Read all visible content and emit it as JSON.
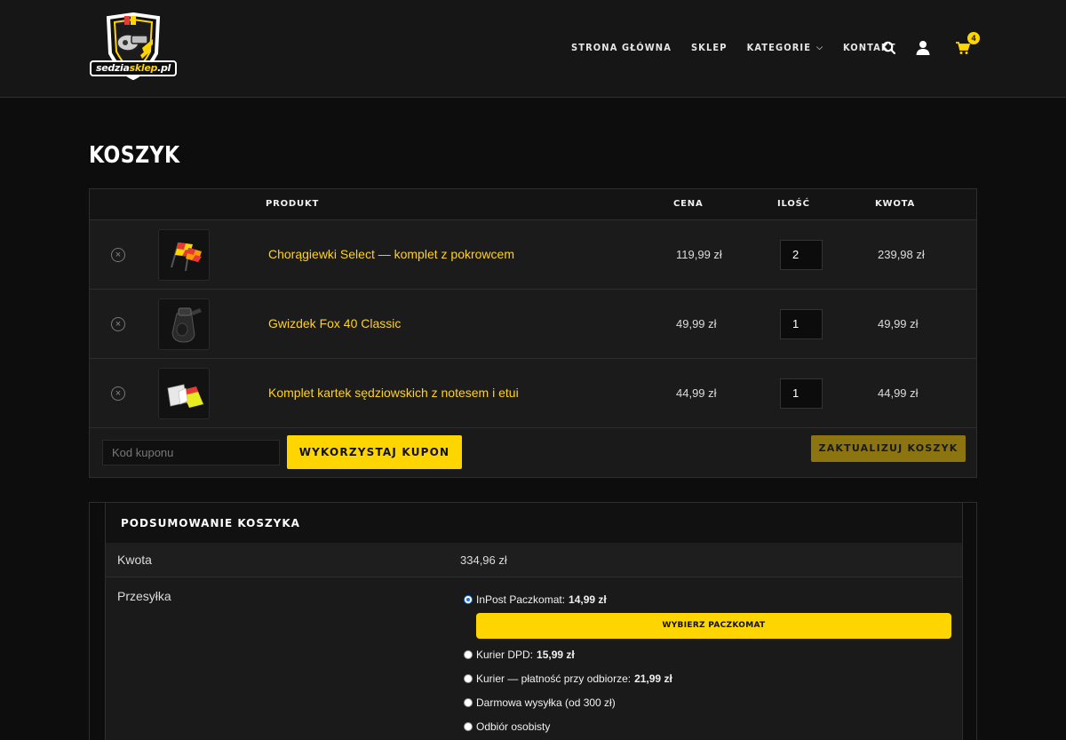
{
  "header": {
    "logo_text_white": "sedzia",
    "logo_text_yellow": "sklep",
    "logo_text_domain": ".pl",
    "nav": [
      {
        "label": "STRONA GŁÓWNA"
      },
      {
        "label": "SKLEP"
      },
      {
        "label": "KATEGORIE"
      },
      {
        "label": "KONTAKT"
      }
    ],
    "cart_count": "4",
    "accent": "#ffd500"
  },
  "page": {
    "title": "KOSZYK"
  },
  "cart": {
    "columns": {
      "product": "PRODUKT",
      "price": "CENA",
      "qty": "ILOŚĆ",
      "total": "KWOTA"
    },
    "rows": [
      {
        "name": "Chorągiewki Select — komplet z pokrowcem",
        "price": "119,99 zł",
        "qty": "2",
        "subtotal": "239,98 zł",
        "icon": "flags-icon"
      },
      {
        "name": "Gwizdek Fox 40 Classic",
        "price": "49,99 zł",
        "qty": "1",
        "subtotal": "49,99 zł",
        "icon": "whistle-icon"
      },
      {
        "name": "Komplet kartek sędziowskich z notesem i etui",
        "price": "44,99 zł",
        "qty": "1",
        "subtotal": "44,99 zł",
        "icon": "cards-icon"
      }
    ],
    "coupon_placeholder": "Kod kuponu",
    "apply_coupon_label": "WYKORZYSTAJ KUPON",
    "update_cart_label": "ZAKTUALIZUJ KOSZYK"
  },
  "summary": {
    "title": "PODSUMOWANIE KOSZYKA",
    "subtotal_label": "Kwota",
    "subtotal_value": "334,96 zł",
    "shipping_label": "Przesyłka",
    "shipping_options": [
      {
        "label": "InPost Paczkomat:",
        "price": "14,99 zł",
        "selected": true
      },
      {
        "label": "Kurier DPD:",
        "price": "15,99 zł",
        "selected": false
      },
      {
        "label": "Kurier — płatność przy odbiorze:",
        "price": "21,99 zł",
        "selected": false
      },
      {
        "label": "Darmowa wysyłka (od 300 zł)",
        "price": "",
        "selected": false
      },
      {
        "label": "Odbiór osobisty",
        "price": "",
        "selected": false
      }
    ],
    "paczkomat_button": "WYBIERZ PACZKOMAT"
  }
}
